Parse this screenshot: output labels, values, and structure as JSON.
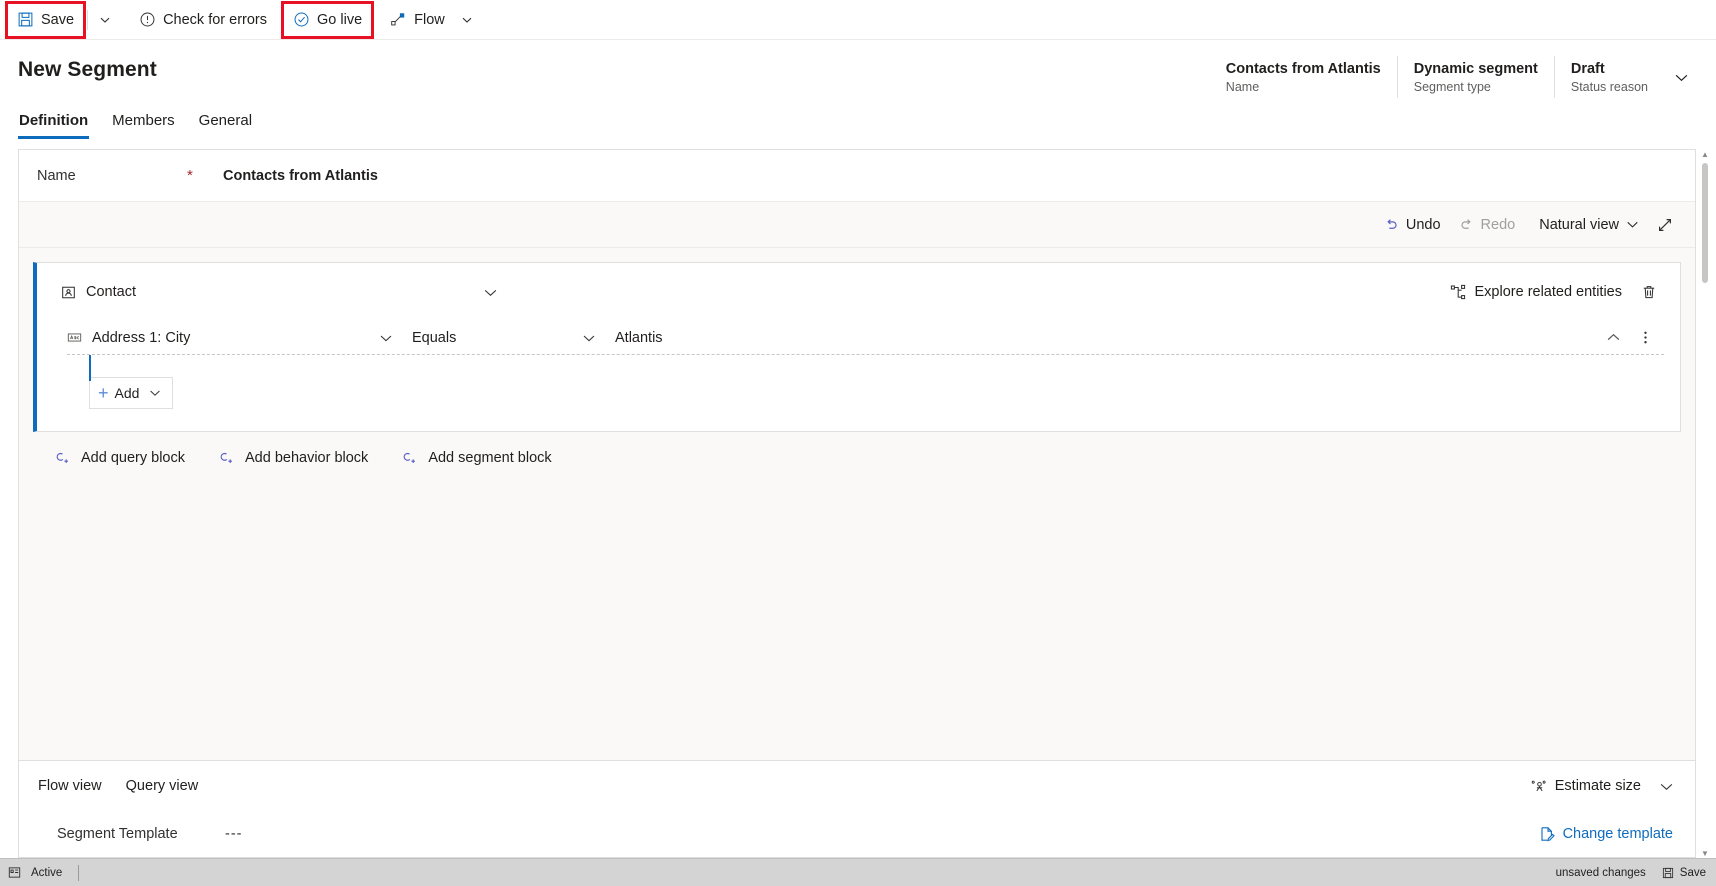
{
  "commandbar": {
    "save_label": "Save",
    "save_caret_icon": "chevron-down-icon",
    "check_errors_label": "Check for errors",
    "go_live_label": "Go live",
    "flow_label": "Flow",
    "flow_caret_icon": "chevron-down-icon",
    "highlight_color": "#e81123"
  },
  "header": {
    "title": "New Segment",
    "fields": [
      {
        "value": "Contacts from Atlantis",
        "label": "Name"
      },
      {
        "value": "Dynamic segment",
        "label": "Segment type"
      },
      {
        "value": "Draft",
        "label": "Status reason"
      }
    ],
    "expand_icon": "chevron-down-icon"
  },
  "tabs": [
    {
      "label": "Definition",
      "active": true
    },
    {
      "label": "Members",
      "active": false
    },
    {
      "label": "General",
      "active": false
    }
  ],
  "name_row": {
    "label": "Name",
    "required_marker": "*",
    "value": "Contacts from Atlantis"
  },
  "editor_toolbar": {
    "undo_label": "Undo",
    "redo_label": "Redo",
    "view_label": "Natural view",
    "view_caret_icon": "chevron-down-icon",
    "expand_icon": "expand-diagonal-icon"
  },
  "query_block": {
    "entity_label": "Contact",
    "entity_icon": "contact-entity-icon",
    "collapse_icon": "chevron-down-icon",
    "explore_label": "Explore related entities",
    "explore_icon": "related-entities-icon",
    "delete_icon": "trash-icon",
    "condition": {
      "attribute": "Address 1: City",
      "attribute_icon": "text-field-icon",
      "attribute_caret_icon": "chevron-down-icon",
      "operator": "Equals",
      "operator_caret_icon": "chevron-down-icon",
      "value": "Atlantis",
      "collapse_icon": "chevron-up-icon",
      "more_icon": "more-vertical-icon"
    },
    "add_button": {
      "label": "Add",
      "plus_icon": "plus-icon",
      "caret_icon": "chevron-down-icon"
    }
  },
  "block_links": [
    {
      "label": "Add query block",
      "icon": "add-block-icon"
    },
    {
      "label": "Add behavior block",
      "icon": "add-block-icon"
    },
    {
      "label": "Add segment block",
      "icon": "add-block-icon"
    }
  ],
  "bottom_panel": {
    "view_tabs": [
      {
        "label": "Flow view"
      },
      {
        "label": "Query view"
      }
    ],
    "estimate_label": "Estimate size",
    "estimate_icon": "people-icon",
    "estimate_caret_icon": "chevron-down-icon",
    "template_label": "Segment Template",
    "template_value": "---",
    "change_template_label": "Change template",
    "change_template_icon": "document-edit-icon"
  },
  "statusbar": {
    "left_icon": "form-icon",
    "state_label": "Active",
    "unsaved_label": "unsaved changes",
    "save_label": "Save",
    "save_icon": "save-icon"
  }
}
